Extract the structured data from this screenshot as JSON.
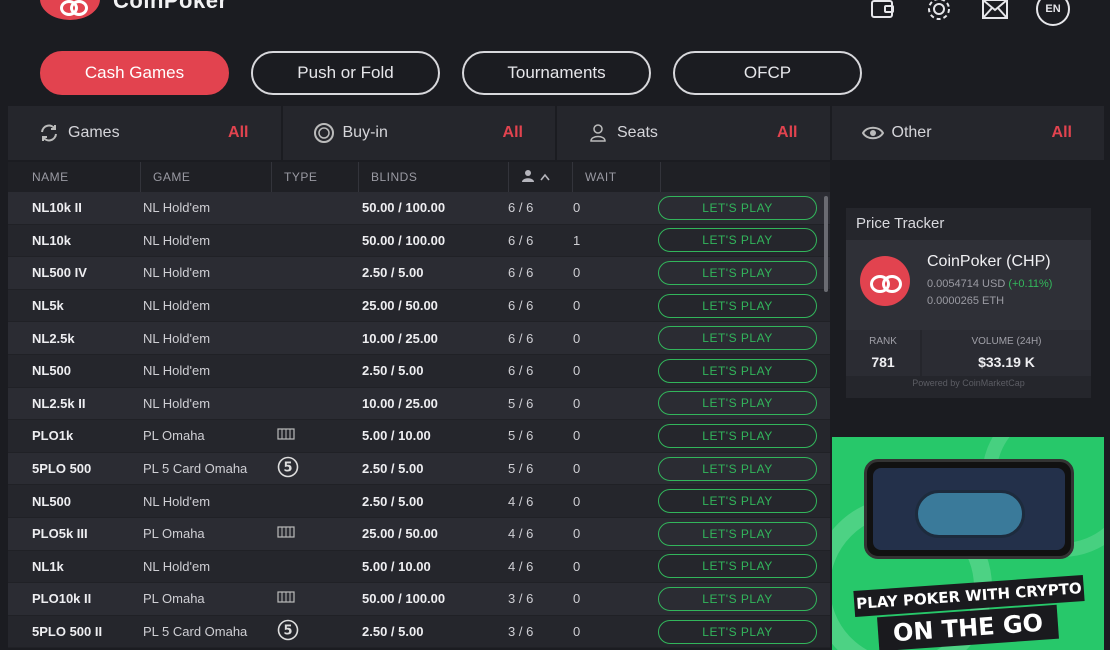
{
  "app": {
    "brand": "CoinPoker"
  },
  "header": {
    "icons": [
      "wallet-icon",
      "gear-icon",
      "mail-icon"
    ],
    "language": "EN"
  },
  "tabs": [
    {
      "label": "Cash Games",
      "active": true
    },
    {
      "label": "Push or Fold",
      "active": false
    },
    {
      "label": "Tournaments",
      "active": false
    },
    {
      "label": "OFCP",
      "active": false
    }
  ],
  "filters": [
    {
      "label": "Games",
      "value": "All",
      "icon": "refresh-icon"
    },
    {
      "label": "Buy-in",
      "value": "All",
      "icon": "chip-icon"
    },
    {
      "label": "Seats",
      "value": "All",
      "icon": "user-icon"
    },
    {
      "label": "Other",
      "value": "All",
      "icon": "eye-icon"
    }
  ],
  "table": {
    "columns": [
      "NAME",
      "GAME",
      "TYPE",
      "BLINDS",
      "",
      "WAIT"
    ],
    "play_label": "LET'S PLAY",
    "rows": [
      {
        "name": "NL10k II",
        "game": "NL Hold'em",
        "type": "",
        "blinds": "50.00 / 100.00",
        "seats": "6 / 6",
        "wait": "0"
      },
      {
        "name": "NL10k",
        "game": "NL Hold'em",
        "type": "",
        "blinds": "50.00 / 100.00",
        "seats": "6 / 6",
        "wait": "1"
      },
      {
        "name": "NL500 IV",
        "game": "NL Hold'em",
        "type": "",
        "blinds": "2.50 / 5.00",
        "seats": "6 / 6",
        "wait": "0"
      },
      {
        "name": "NL5k",
        "game": "NL Hold'em",
        "type": "",
        "blinds": "25.00 / 50.00",
        "seats": "6 / 6",
        "wait": "0"
      },
      {
        "name": "NL2.5k",
        "game": "NL Hold'em",
        "type": "",
        "blinds": "10.00 / 25.00",
        "seats": "6 / 6",
        "wait": "0"
      },
      {
        "name": "NL500",
        "game": "NL Hold'em",
        "type": "",
        "blinds": "2.50 / 5.00",
        "seats": "6 / 6",
        "wait": "0"
      },
      {
        "name": "NL2.5k II",
        "game": "NL Hold'em",
        "type": "",
        "blinds": "10.00 / 25.00",
        "seats": "5 / 6",
        "wait": "0"
      },
      {
        "name": "PLO1k",
        "game": "PL Omaha",
        "type": "cards",
        "blinds": "5.00 / 10.00",
        "seats": "5 / 6",
        "wait": "0"
      },
      {
        "name": "5PLO 500",
        "game": "PL 5 Card Omaha",
        "type": "5",
        "blinds": "2.50 / 5.00",
        "seats": "5 / 6",
        "wait": "0"
      },
      {
        "name": "NL500",
        "game": "NL Hold'em",
        "type": "",
        "blinds": "2.50 / 5.00",
        "seats": "4 / 6",
        "wait": "0"
      },
      {
        "name": "PLO5k III",
        "game": "PL Omaha",
        "type": "cards",
        "blinds": "25.00 / 50.00",
        "seats": "4 / 6",
        "wait": "0"
      },
      {
        "name": "NL1k",
        "game": "NL Hold'em",
        "type": "",
        "blinds": "5.00 / 10.00",
        "seats": "4 / 6",
        "wait": "0"
      },
      {
        "name": "PLO10k II",
        "game": "PL Omaha",
        "type": "cards",
        "blinds": "50.00 / 100.00",
        "seats": "3 / 6",
        "wait": "0"
      },
      {
        "name": "5PLO 500 II",
        "game": "PL 5 Card Omaha",
        "type": "5",
        "blinds": "2.50 / 5.00",
        "seats": "3 / 6",
        "wait": "0"
      }
    ]
  },
  "tracker": {
    "title": "Price Tracker",
    "coin_name": "CoinPoker (CHP)",
    "usd": "0.0054714 USD",
    "change": "(+0.11%)",
    "eth": "0.0000265 ETH",
    "rank_label": "RANK",
    "rank_value": "781",
    "volume_label": "VOLUME (24H)",
    "volume_value": "$33.19 K",
    "powered": "Powered by CoinMarketCap"
  },
  "ad": {
    "line1": "PLAY POKER WITH CRYPTO",
    "line2": "ON THE GO"
  },
  "colors": {
    "accent": "#e2434f",
    "play": "#32b55b",
    "bg": "#1b1c21"
  }
}
